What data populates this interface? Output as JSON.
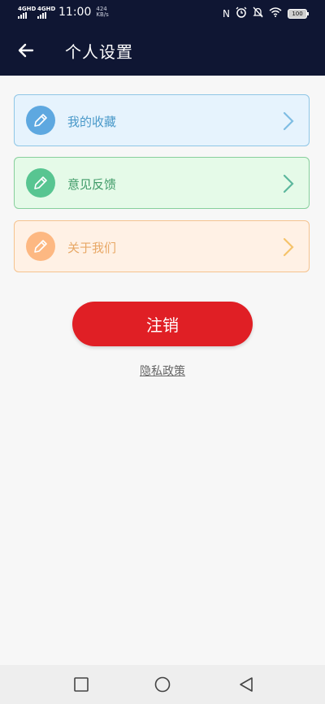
{
  "status_bar": {
    "sim1": "4GHD",
    "sim2": "4GHD",
    "time": "11:00",
    "speed_value": "424",
    "speed_unit": "KB/s",
    "battery": "100",
    "icons": [
      "nfc-icon",
      "alarm-icon",
      "mute-icon",
      "wifi-icon",
      "battery-icon"
    ]
  },
  "app_bar": {
    "back_icon": "arrow-left-icon",
    "title": "个人设置"
  },
  "menu": {
    "items": [
      {
        "label": "我的收藏",
        "icon": "pencil-icon",
        "color": "#5ea8e0"
      },
      {
        "label": "意见反馈",
        "icon": "pencil-icon",
        "color": "#58c591"
      },
      {
        "label": "关于我们",
        "icon": "pencil-icon",
        "color": "#fdb882"
      }
    ]
  },
  "logout": {
    "label": "注销",
    "color": "#e01f25"
  },
  "privacy_link": "隐私政策",
  "nav_bar": {
    "buttons": [
      "recent-apps-icon",
      "home-icon",
      "back-icon"
    ]
  }
}
